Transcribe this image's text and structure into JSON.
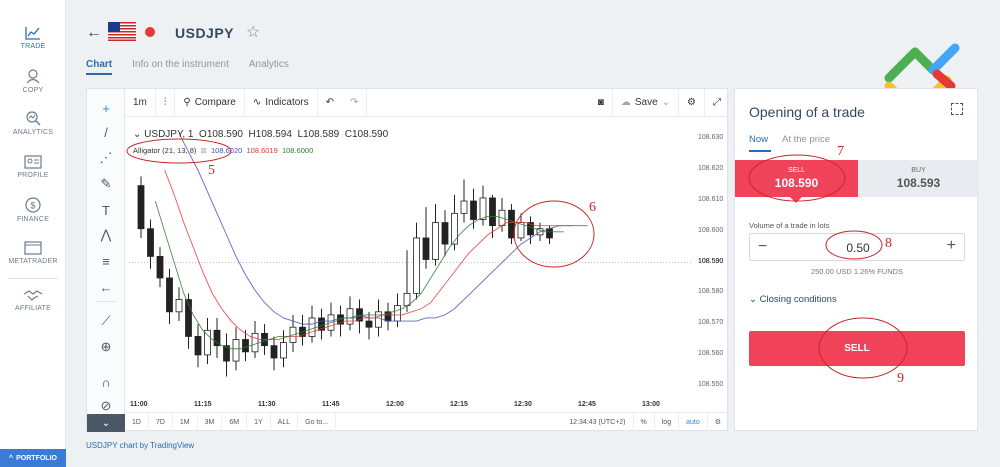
{
  "nav": {
    "items": [
      {
        "label": "TRADE",
        "icon": "trade-chart-icon",
        "active": true
      },
      {
        "label": "COPY",
        "icon": "copy-icon",
        "active": false
      },
      {
        "label": "ANALYTICS",
        "icon": "analytics-icon",
        "active": false
      },
      {
        "label": "PROFILE",
        "icon": "profile-icon",
        "active": false
      },
      {
        "label": "FINANCE",
        "icon": "finance-icon",
        "active": false
      },
      {
        "label": "METATRADER",
        "icon": "metatrader-icon",
        "active": false
      },
      {
        "label": "AFFILIATE",
        "icon": "affiliate-icon",
        "active": false
      }
    ],
    "portfolio": "PORTFOLIO"
  },
  "header": {
    "symbol": "USDJPY",
    "tabs": [
      {
        "label": "Chart",
        "active": true
      },
      {
        "label": "Info on the instrument",
        "active": false
      },
      {
        "label": "Analytics",
        "active": false
      }
    ]
  },
  "toolbar": {
    "interval": "1m",
    "compare": "Compare",
    "indicators": "Indicators",
    "save": "Save"
  },
  "legend": {
    "symbol": "USDJPY",
    "interval": "1",
    "open_label": "O",
    "open": "108.590",
    "high_label": "H",
    "high": "108.594",
    "low_label": "L",
    "low": "108.589",
    "close_label": "C",
    "close": "108.590",
    "indicator": "Alligator (21, 13, 8)",
    "jaw": "108.6020",
    "teeth": "108.6019",
    "lips": "108.6000"
  },
  "bottombar": {
    "ranges": [
      "1D",
      "7D",
      "1M",
      "3M",
      "6M",
      "1Y",
      "ALL"
    ],
    "goto": "Go to...",
    "time": "12:34:43 (UTC+2)",
    "percent": "%",
    "log": "log",
    "auto": "auto"
  },
  "annotations": [
    "5",
    "6",
    "7",
    "8",
    "9"
  ],
  "credit": "USDJPY chart by TradingView",
  "trade": {
    "title": "Opening of a trade",
    "tabs": [
      {
        "label": "Now",
        "active": true
      },
      {
        "label": "At the price",
        "active": false
      }
    ],
    "sell_label": "SELL",
    "sell_price": "108.590",
    "buy_label": "BUY",
    "buy_price": "108.593",
    "volume_label": "Volume of a trade in lots",
    "volume_value": "0.50",
    "funds": "250.00 USD   1.26% FUNDS",
    "closing": "Closing conditions",
    "sell_button": "SELL"
  },
  "colors": {
    "sell": "#f0435a",
    "accent": "#2b6cb0",
    "jaw": "#3f51b5",
    "teeth": "#e53935",
    "lips": "#2e7d32"
  },
  "chart_data": {
    "type": "candlestick",
    "x_ticks": [
      "11:00",
      "11:15",
      "11:30",
      "11:45",
      "12:00",
      "12:15",
      "12:30",
      "12:45",
      "13:00"
    ],
    "y_ticks": [
      108.55,
      108.56,
      108.57,
      108.58,
      108.59,
      108.6,
      108.61,
      108.62,
      108.63
    ],
    "ylim": [
      108.546,
      108.636
    ],
    "current_price": "108.590",
    "candles": [
      [
        108.615,
        108.601,
        108.618,
        108.598
      ],
      [
        108.601,
        108.592,
        108.604,
        108.588
      ],
      [
        108.592,
        108.585,
        108.595,
        108.582
      ],
      [
        108.585,
        108.574,
        108.588,
        108.57
      ],
      [
        108.574,
        108.578,
        108.582,
        108.571
      ],
      [
        108.578,
        108.566,
        108.58,
        108.562
      ],
      [
        108.566,
        108.56,
        108.57,
        108.556
      ],
      [
        108.56,
        108.568,
        108.572,
        108.557
      ],
      [
        108.568,
        108.563,
        108.572,
        108.559
      ],
      [
        108.563,
        108.558,
        108.567,
        108.553
      ],
      [
        108.558,
        108.565,
        108.569,
        108.555
      ],
      [
        108.565,
        108.561,
        108.568,
        108.558
      ],
      [
        108.561,
        108.567,
        108.571,
        108.559
      ],
      [
        108.567,
        108.563,
        108.57,
        108.56
      ],
      [
        108.563,
        108.559,
        108.566,
        108.555
      ],
      [
        108.559,
        108.564,
        108.568,
        108.556
      ],
      [
        108.564,
        108.569,
        108.573,
        108.561
      ],
      [
        108.569,
        108.566,
        108.573,
        108.563
      ],
      [
        108.566,
        108.572,
        108.576,
        108.564
      ],
      [
        108.572,
        108.568,
        108.575,
        108.565
      ],
      [
        108.568,
        108.573,
        108.577,
        108.566
      ],
      [
        108.573,
        108.57,
        108.576,
        108.566
      ],
      [
        108.57,
        108.575,
        108.579,
        108.568
      ],
      [
        108.575,
        108.571,
        108.578,
        108.567
      ],
      [
        108.571,
        108.569,
        108.574,
        108.565
      ],
      [
        108.569,
        108.574,
        108.578,
        108.566
      ],
      [
        108.574,
        108.571,
        108.577,
        108.568
      ],
      [
        108.571,
        108.576,
        108.58,
        108.569
      ],
      [
        108.576,
        108.58,
        108.594,
        108.574
      ],
      [
        108.58,
        108.598,
        108.603,
        108.578
      ],
      [
        108.598,
        108.591,
        108.608,
        108.588
      ],
      [
        108.591,
        108.603,
        108.609,
        108.589
      ],
      [
        108.603,
        108.596,
        108.607,
        108.592
      ],
      [
        108.596,
        108.606,
        108.612,
        108.594
      ],
      [
        108.606,
        108.61,
        108.617,
        108.603
      ],
      [
        108.61,
        108.604,
        108.614,
        108.601
      ],
      [
        108.604,
        108.611,
        108.615,
        108.602
      ],
      [
        108.611,
        108.602,
        108.612,
        108.598
      ],
      [
        108.602,
        108.607,
        108.611,
        108.6
      ],
      [
        108.607,
        108.598,
        108.609,
        108.596
      ],
      [
        108.598,
        108.603,
        108.606,
        108.597
      ],
      [
        108.603,
        108.599,
        108.605,
        108.596
      ],
      [
        108.599,
        108.601,
        108.603,
        108.597
      ],
      [
        108.601,
        108.598,
        108.602,
        108.596
      ]
    ],
    "series": [
      {
        "name": "jaw",
        "values": [
          108.632,
          108.626,
          108.62,
          108.613,
          108.606,
          108.599,
          108.592,
          108.586,
          108.581,
          108.577,
          108.574,
          108.572,
          108.571,
          108.57,
          108.57,
          108.571,
          108.571,
          108.572,
          108.572,
          108.573,
          108.572,
          108.572,
          108.571,
          108.571,
          108.571,
          108.571,
          108.572,
          108.572,
          108.573,
          108.575,
          108.578,
          108.581,
          108.584,
          108.587,
          108.59,
          108.593,
          108.596,
          108.598,
          108.6,
          108.601,
          108.602,
          108.602,
          108.602,
          108.602
        ]
      },
      {
        "name": "teeth",
        "values": [
          108.62,
          108.612,
          108.603,
          108.595,
          108.587,
          108.58,
          108.575,
          108.571,
          108.568,
          108.566,
          108.565,
          108.565,
          108.565,
          108.566,
          108.566,
          108.567,
          108.568,
          108.569,
          108.57,
          108.571,
          108.571,
          108.572,
          108.572,
          108.573,
          108.573,
          108.573,
          108.574,
          108.575,
          108.577,
          108.581,
          108.585,
          108.589,
          108.593,
          108.596,
          108.599,
          108.601,
          108.603,
          108.603,
          108.603,
          108.602,
          108.602,
          108.602,
          108.602,
          108.602
        ]
      },
      {
        "name": "lips",
        "values": [
          108.61,
          108.6,
          108.59,
          108.58,
          108.573,
          108.568,
          108.565,
          108.563,
          108.562,
          108.562,
          108.563,
          108.564,
          108.565,
          108.566,
          108.566,
          108.567,
          108.568,
          108.569,
          108.57,
          108.571,
          108.572,
          108.572,
          108.573,
          108.573,
          108.573,
          108.574,
          108.575,
          108.577,
          108.58,
          108.585,
          108.59,
          108.595,
          108.599,
          108.602,
          108.604,
          108.605,
          108.605,
          108.604,
          108.603,
          108.602,
          108.601,
          108.6,
          108.6,
          108.6
        ]
      }
    ]
  }
}
